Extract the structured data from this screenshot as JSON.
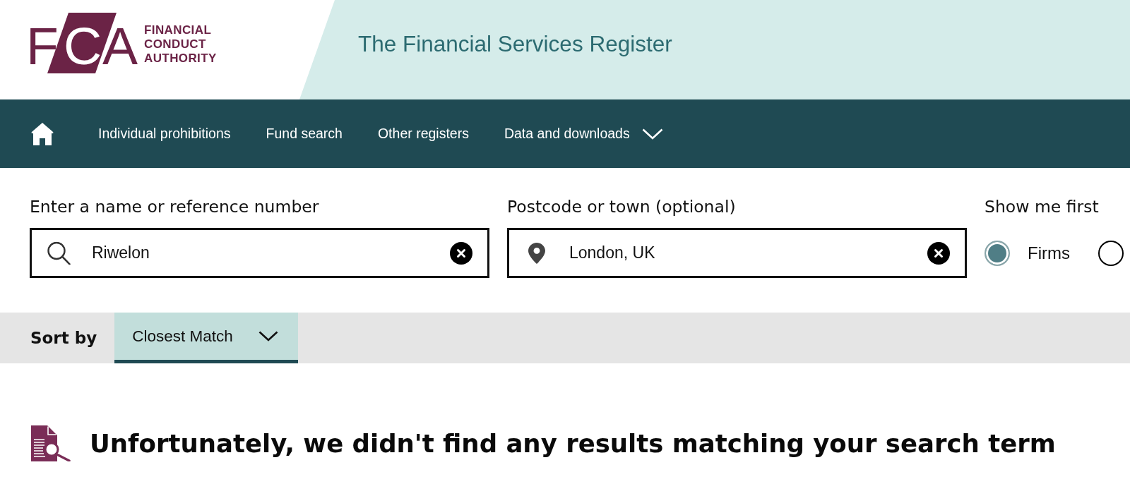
{
  "header": {
    "logo": {
      "mark": "FCA",
      "wordmark": [
        "FINANCIAL",
        "CONDUCT",
        "AUTHORITY"
      ]
    },
    "title": "The Financial Services Register"
  },
  "nav": {
    "items": [
      {
        "kind": "link",
        "label": "Individual prohibitions"
      },
      {
        "kind": "link",
        "label": "Fund search"
      },
      {
        "kind": "link",
        "label": "Other registers"
      },
      {
        "kind": "dropdown",
        "label": "Data and downloads"
      }
    ]
  },
  "search": {
    "fields": [
      {
        "kind": "name",
        "label": "Enter a name or reference number",
        "value": "Riwelon"
      },
      {
        "kind": "location",
        "label": "Postcode or town (optional)",
        "value": "London, UK"
      }
    ],
    "show_first": {
      "label": "Show me first",
      "options": [
        {
          "label": "Firms",
          "selected": true
        },
        {
          "selected": false
        }
      ]
    }
  },
  "sort": {
    "label": "Sort by",
    "value": "Closest Match"
  },
  "message": {
    "text": "Unfortunately, we didn't find any results matching your search term"
  }
}
